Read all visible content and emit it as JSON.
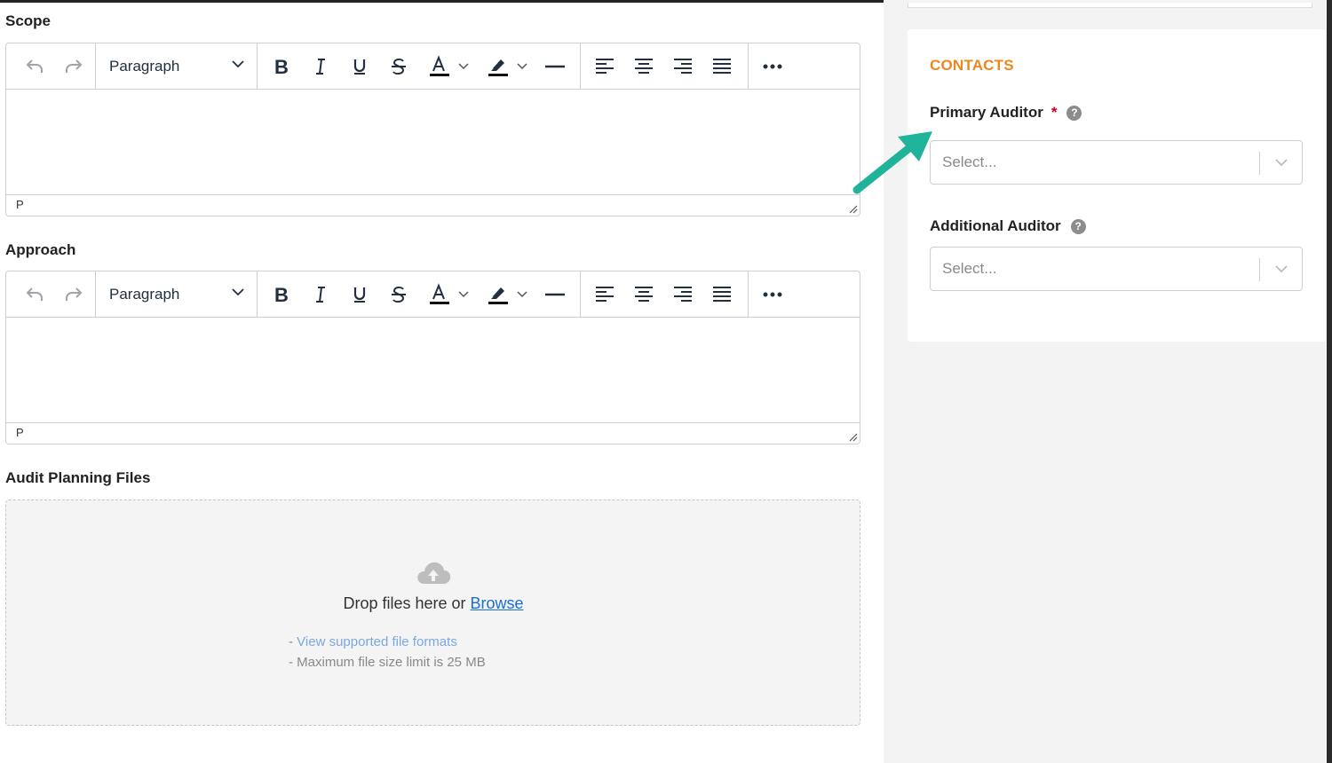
{
  "scope": {
    "label": "Scope",
    "block_format": "Paragraph",
    "status_path": "P"
  },
  "approach": {
    "label": "Approach",
    "block_format": "Paragraph",
    "status_path": "P"
  },
  "files": {
    "label": "Audit Planning Files",
    "drop_text": "Drop files here or ",
    "browse_link": "Browse",
    "supported_prefix": "- ",
    "supported_link": "View supported file formats",
    "max_size": "- Maximum file size limit is 25 MB"
  },
  "contacts": {
    "title": "CONTACTS",
    "primary_auditor": {
      "label": "Primary Auditor",
      "required_mark": "*",
      "help": "?",
      "placeholder": "Select..."
    },
    "additional_auditor": {
      "label": "Additional Auditor",
      "help": "?",
      "placeholder": "Select..."
    }
  },
  "colors": {
    "section_title": "#f0861e",
    "required": "#d0021b",
    "link": "#1a6fd1",
    "annotation_arrow": "#1fb39a"
  },
  "icons": [
    "undo-icon",
    "redo-icon",
    "bold-icon",
    "italic-icon",
    "underline-icon",
    "strikethrough-icon",
    "text-color-icon",
    "highlight-icon",
    "horizontal-rule-icon",
    "align-left-icon",
    "align-center-icon",
    "align-right-icon",
    "justify-icon",
    "more-icon",
    "cloud-upload-icon",
    "help-icon",
    "chevron-down-icon"
  ]
}
